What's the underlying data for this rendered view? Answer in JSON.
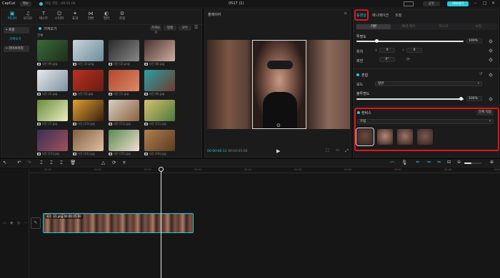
{
  "app": {
    "title": "0517 (1)",
    "logo": "CapCut",
    "menu": "메뉴",
    "autosave": "자동 저장 : 09:55:08",
    "btn_save": "공유",
    "btn_export": "내보내기"
  },
  "top_tools": [
    {
      "label": "미디어",
      "icon": "media-icon",
      "active": true
    },
    {
      "label": "오디오",
      "icon": "audio-icon"
    },
    {
      "label": "텍스트",
      "icon": "text-icon"
    },
    {
      "label": "스티커",
      "icon": "sticker-icon"
    },
    {
      "label": "효과",
      "icon": "effect-icon"
    },
    {
      "label": "전환",
      "icon": "transition-icon"
    },
    {
      "label": "필터",
      "icon": "filter-icon"
    },
    {
      "label": "조정",
      "icon": "adjust-icon"
    }
  ],
  "left_nav": [
    "• 로컬",
    "가져오기",
    "• 라이브러리"
  ],
  "media": {
    "header": "가져오기",
    "sub": "전체",
    "import_btn": "가져오기",
    "sort_btn": "정렬",
    "view_btn": "모두",
    "items": [
      {
        "name": "사진 (9).jpg",
        "c1": "#3a6b3a",
        "c2": "#1e2e1a"
      },
      {
        "name": "사진 (3).png",
        "c1": "#c8d4dc",
        "c2": "#6d8d9a"
      },
      {
        "name": "사진 (2).png",
        "c1": "#2a2a2a",
        "c2": "#888"
      },
      {
        "name": "사진 (8).jpg",
        "c1": "#4a3030",
        "c2": "#d0b0a0"
      },
      {
        "name": "사진 (4).jpg",
        "c1": "#eaeaea",
        "c2": "#7d8fa3"
      },
      {
        "name": "사진 (5).jpg",
        "c1": "#b83222",
        "c2": "#6b1b12"
      },
      {
        "name": "사진 (1).jpg",
        "c1": "#b5462c",
        "c2": "#d98a6a"
      },
      {
        "name": "사진 (6).jpg",
        "c1": "#2aa0a8",
        "c2": "#6f3a2a"
      },
      {
        "name": "사진 (7).jpg",
        "c1": "#6c8a3a",
        "c2": "#e8f0c0"
      },
      {
        "name": "사진 (10).jpg",
        "c1": "#e0a030",
        "c2": "#3a2010"
      },
      {
        "name": "사진 (11).jpg",
        "c1": "#d8d0c0",
        "c2": "#8a6040"
      },
      {
        "name": "사진 (12).jpg",
        "c1": "#d8c070",
        "c2": "#4a7a3a"
      },
      {
        "name": "사진 (13).jpg",
        "c1": "#3a3050",
        "c2": "#a05060"
      },
      {
        "name": "사진 (14).jpg",
        "c1": "#806040",
        "c2": "#e0c0a0"
      },
      {
        "name": "사진 (15).jpg",
        "c1": "#5a8a50",
        "c2": "#f0e0d0"
      },
      {
        "name": "사진 (16).jpg",
        "c1": "#b08050",
        "c2": "#5a3a20"
      }
    ]
  },
  "player": {
    "title": "플레이어",
    "time_current": "00:00:00:11",
    "time_total": "00:00:05:00"
  },
  "right": {
    "tabs": [
      "동영상",
      "애니메이션",
      "조정"
    ],
    "subtabs": [
      "기본",
      "배경 제거",
      "마스크",
      "보정"
    ],
    "opacity_label": "투명도",
    "opacity_value": "100%",
    "pos_label": "위치",
    "pos_x": "0",
    "pos_y": "0",
    "rot_label": "회전",
    "rot_value": "0°",
    "blend_label": "혼합",
    "mode_label": "모드",
    "mode_value": "일반",
    "blend_opacity_label": "불투명도",
    "blend_opacity_value": "100%",
    "canvas_label": "캔버스",
    "apply_all": "전체 적용",
    "blur_select": "흐림",
    "swatches": [
      "#6b4a40",
      "#b5877a",
      "#9a7466",
      "#7a5a52"
    ]
  },
  "timeline": {
    "ticks": [
      "00:00",
      "00:01",
      "00:02",
      "00:03",
      "00:04",
      "00:05",
      "00:06",
      "00:07",
      "00:08",
      "00:09"
    ],
    "clip_label": "사진 (2).png  00:00:05:00"
  }
}
